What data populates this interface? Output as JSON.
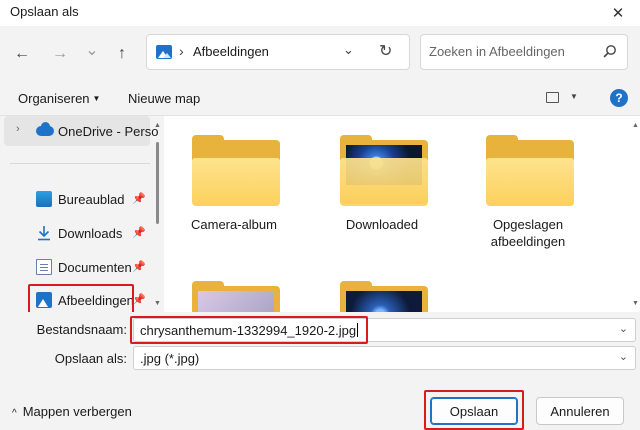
{
  "window": {
    "title": "Opslaan als",
    "close_glyph": "✕"
  },
  "nav": {
    "back_glyph": "←",
    "forward_glyph": "→",
    "recent_glyph": "⌄",
    "up_glyph": "↑",
    "address": {
      "folder": "Afbeeldingen",
      "separator": "›",
      "dropdown_glyph": "⌄",
      "refresh_glyph": "↻"
    },
    "search": {
      "placeholder": "Zoeken in Afbeeldingen"
    }
  },
  "toolbar": {
    "organize_label": "Organiseren",
    "new_folder_label": "Nieuwe map",
    "caret": "▼",
    "help_label": "?"
  },
  "sidebar": {
    "onedrive_label": "OneDrive - Perso",
    "chevron": "›",
    "pin_glyph": "📌",
    "items": [
      {
        "label": "Bureaublad"
      },
      {
        "label": "Downloads"
      },
      {
        "label": "Documenten"
      },
      {
        "label": "Afbeeldingen"
      }
    ]
  },
  "folders": [
    {
      "label": "Camera-album"
    },
    {
      "label": "Downloaded"
    },
    {
      "label": "Opgeslagen afbeeldingen"
    }
  ],
  "form": {
    "filename_label": "Bestandsnaam:",
    "filename_value": "chrysanthemum-1332994_1920-2.jpg",
    "savetype_label": "Opslaan als:",
    "savetype_value": ".jpg (*.jpg)",
    "dropdown_glyph": "⌄"
  },
  "footer": {
    "hide_folders_label": "Mappen verbergen",
    "hide_glyph": "^",
    "save_label": "Opslaan",
    "cancel_label": "Annuleren"
  },
  "colors": {
    "accent": "#1e73c8",
    "highlight": "#d81b1b",
    "folder": "#fcd15c"
  }
}
